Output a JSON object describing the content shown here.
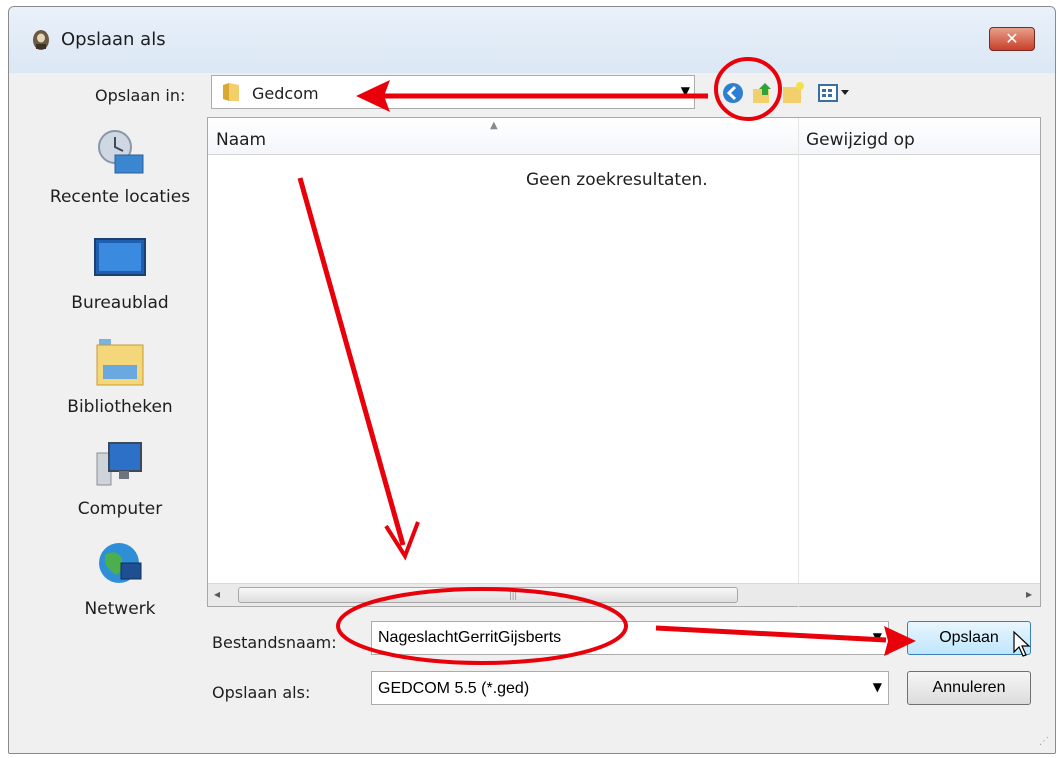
{
  "window": {
    "title": "Opslaan als",
    "close_symbol": "✕"
  },
  "save_in": {
    "label": "Opslaan in:",
    "value": "Gedcom",
    "arrow": "▼"
  },
  "toolbar": {
    "icons": [
      "back-icon",
      "up-folder-icon",
      "new-folder-icon",
      "view-menu-icon"
    ]
  },
  "places": [
    {
      "label": "Recente locaties",
      "icon": "recent-locations-icon"
    },
    {
      "label": "Bureaublad",
      "icon": "desktop-icon"
    },
    {
      "label": "Bibliotheken",
      "icon": "libraries-icon"
    },
    {
      "label": "Computer",
      "icon": "computer-icon"
    },
    {
      "label": "Netwerk",
      "icon": "network-icon"
    }
  ],
  "file_list": {
    "columns": [
      "Naam",
      "Gewijzigd op"
    ],
    "empty_message": "Geen zoekresultaten.",
    "sort_indicator": "▲",
    "scroll_left": "◂",
    "scroll_right": "▸",
    "scroll_grip": "|||"
  },
  "filename": {
    "label": "Bestandsnaam:",
    "value": "NageslachtGerritGijsberts",
    "arrow": "▼"
  },
  "save_type": {
    "label": "Opslaan als:",
    "value": "GEDCOM 5.5 (*.ged)",
    "arrow": "▼"
  },
  "buttons": {
    "save": "Opslaan",
    "cancel": "Annuleren"
  },
  "grip": "⋰",
  "colors": {
    "annotation": "#e8000a",
    "titlebar": "#dbe7f4",
    "save_button_border": "#3c7fb1"
  }
}
